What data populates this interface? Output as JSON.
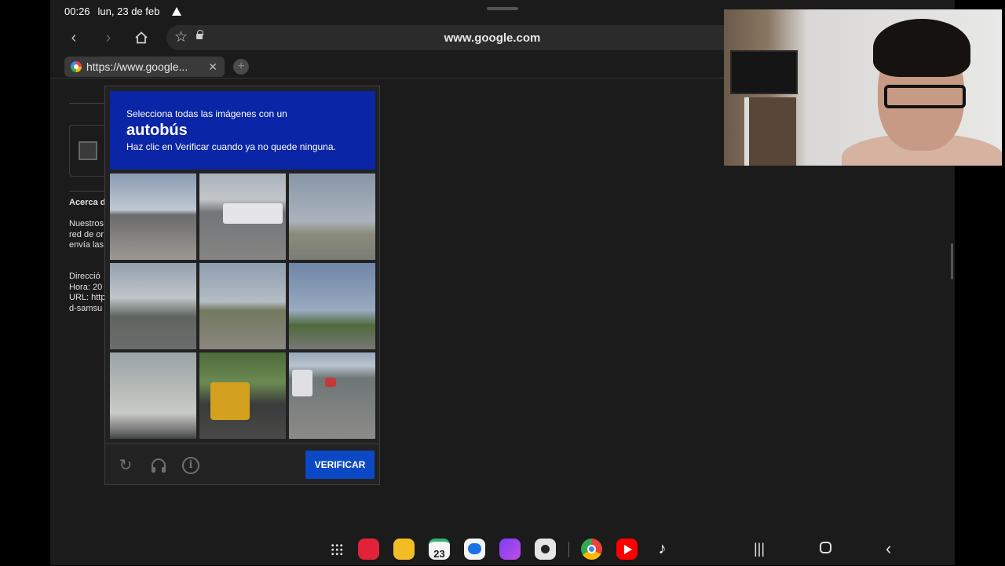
{
  "status_bar": {
    "time": "00:26",
    "date": "lun, 23 de feb"
  },
  "browser": {
    "url": "www.google.com",
    "tab_title": "https://www.google...",
    "new_tab": "+"
  },
  "page_bg": {
    "about_heading": "Acerca d",
    "para1": "Nuestros\nred de or\nenvía las",
    "para2": "Direcció\nHora: 20\nURL: http\nd-samsu"
  },
  "captcha": {
    "instruction_line1": "Selecciona todas las imágenes con un",
    "target_object": "autobús",
    "instruction_line2": "Haz clic en Verificar cuando ya no quede ninguna.",
    "verify_label": "VERIFICAR",
    "colors": {
      "header": "#0a26a6",
      "verify_button": "#0b49c4"
    }
  },
  "dock": {
    "calendar_day": "23",
    "apps": [
      "app-drawer",
      "red-notes",
      "files",
      "calendar",
      "messages",
      "browser-purple",
      "camera",
      "chrome",
      "youtube",
      "tiktok"
    ]
  }
}
